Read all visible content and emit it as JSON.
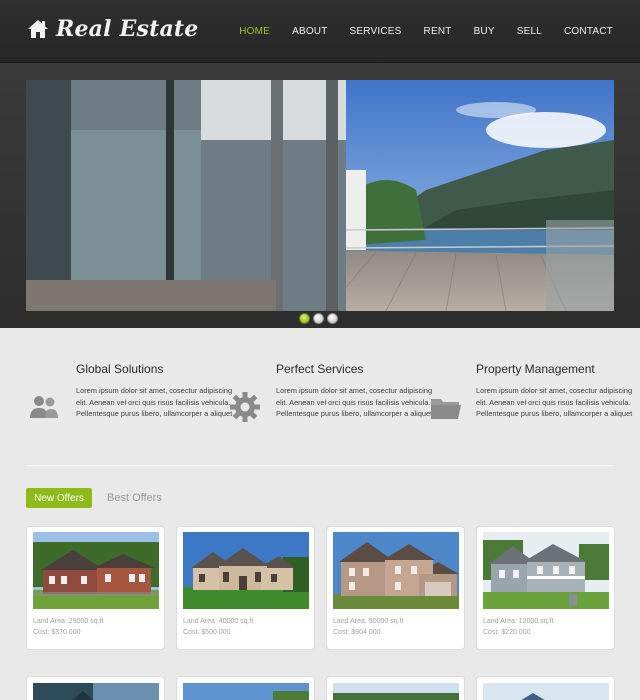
{
  "header": {
    "logo_text": "Real Estate",
    "nav": [
      "HOME",
      "ABOUT",
      "SERVICES",
      "RENT",
      "BUY",
      "SELL",
      "CONTACT"
    ],
    "active_nav": "HOME"
  },
  "slider": {
    "dots": 3,
    "active_dot": 1
  },
  "features": [
    {
      "title": "Global Solutions",
      "text": "Lorem ipsum dolor sit amet, cosectur adipiscing elit. Aenean vel orci quis risus facilisis vehicula. Pellentesque purus libero, ullamcorper a aliquet",
      "icon": "users-icon"
    },
    {
      "title": "Perfect Services",
      "text": "Lorem ipsum dolor sit amet, cosectur adipiscing elit. Aenean vel orci quis risus facilisis vehicula. Pellentesque purus libero, ullamcorper a aliquet",
      "icon": "gear-icon"
    },
    {
      "title": "Property Management",
      "text": "Lorem ipsum dolor sit amet, cosectur adipiscing elit. Aenean vel orci quis risus facilisis vehicula. Pellentesque purus libero, ullamcorper a aliquet",
      "icon": "folder-icon"
    }
  ],
  "tabs": {
    "active": "New Offers",
    "inactive": "Best Offers"
  },
  "offers": [
    {
      "land": "Land Area:  29000 sq.ft",
      "cost": "Cost:  $370 000"
    },
    {
      "land": "Land Area:  40000 sq.ft",
      "cost": "Cost:  $500 000"
    },
    {
      "land": "Land Area:  90000 sq.ft",
      "cost": "Cost:  $904 000"
    },
    {
      "land": "Land Area:  12000 sq.ft",
      "cost": "Cost:  $220 000"
    }
  ],
  "colors": {
    "accent": "#8fbb19",
    "nav_active": "#9cc424",
    "header_bg": "#2b2b2b"
  }
}
